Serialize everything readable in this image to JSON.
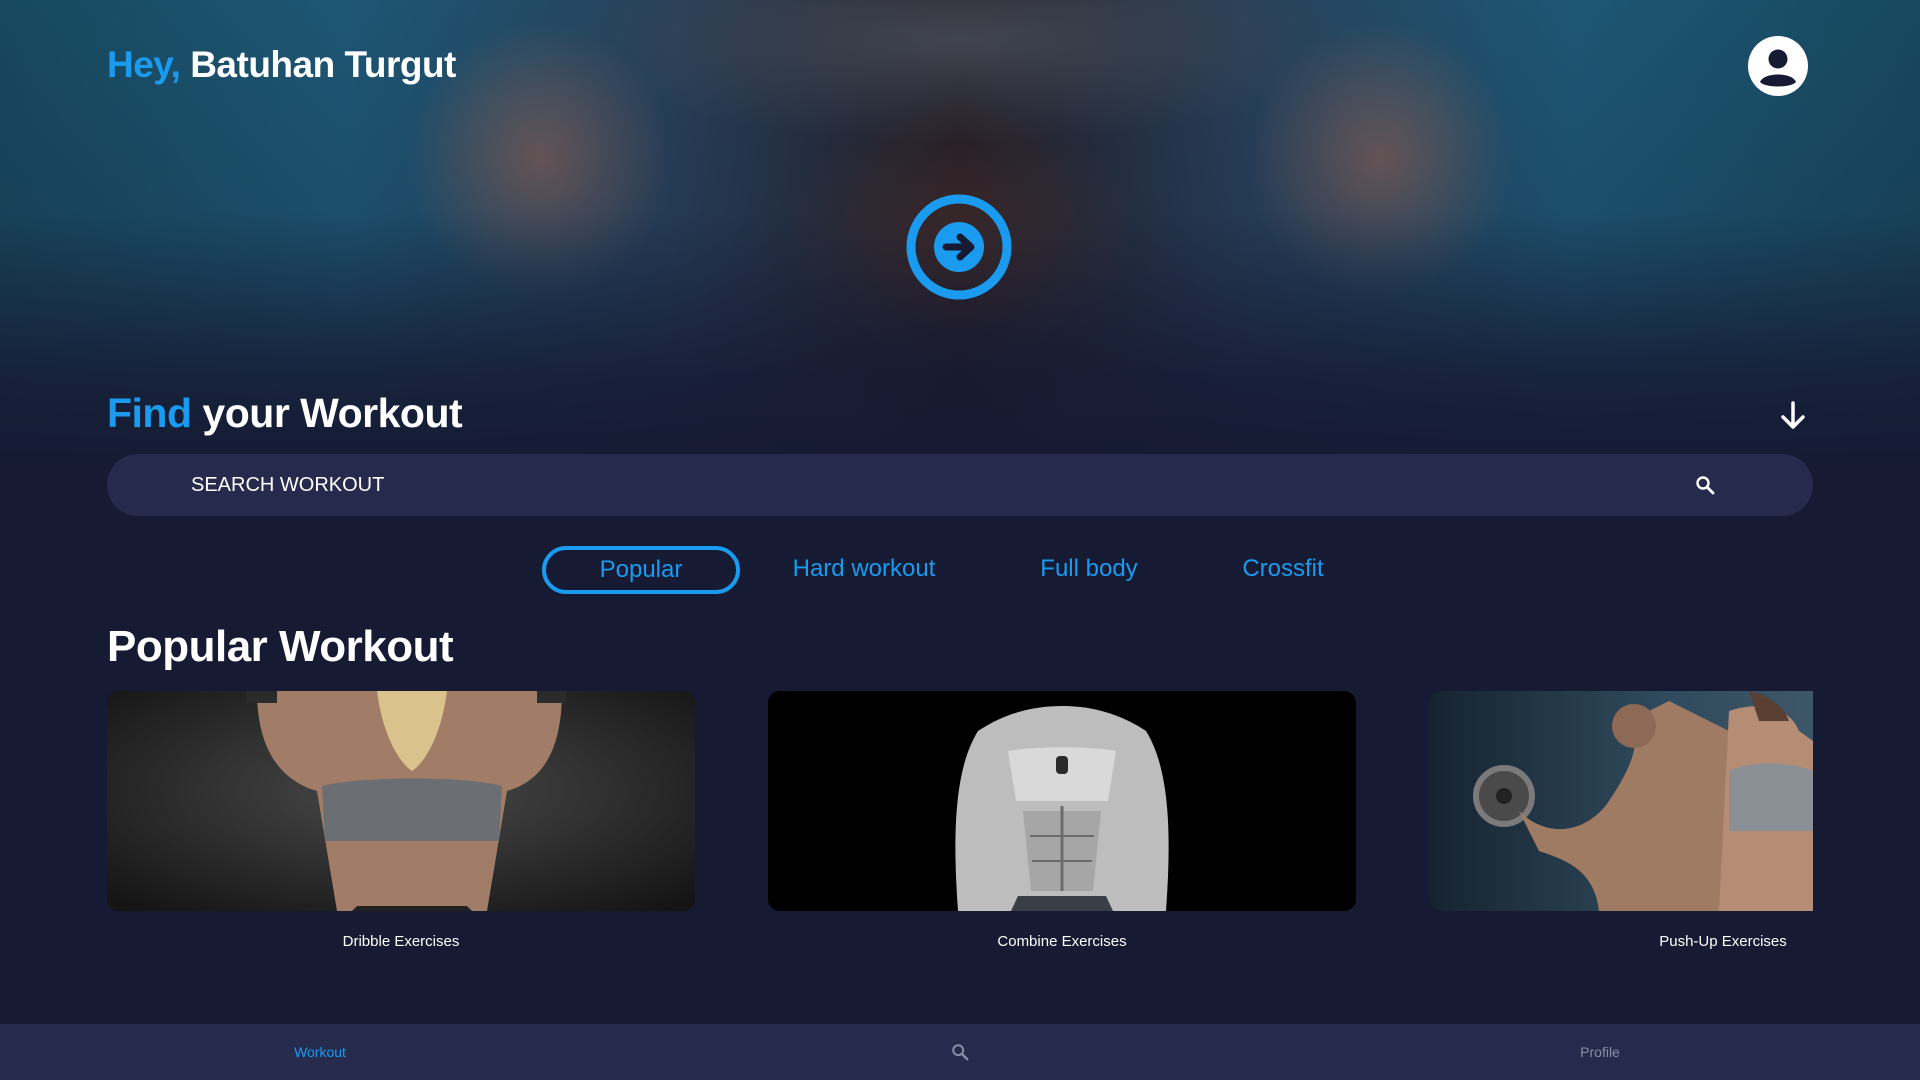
{
  "header": {
    "greeting_prefix": "Hey,",
    "user_name": "Batuhan Turgut"
  },
  "find": {
    "title_accent": "Find",
    "title_rest": " your Workout"
  },
  "search": {
    "placeholder": "SEARCH WORKOUT",
    "value": ""
  },
  "tabs": [
    {
      "label": "Popular",
      "active": true
    },
    {
      "label": "Hard workout",
      "active": false
    },
    {
      "label": "Full body",
      "active": false
    },
    {
      "label": "Crossfit",
      "active": false
    }
  ],
  "section": {
    "title": "Popular Workout"
  },
  "cards": [
    {
      "label": "Dribble Exercises"
    },
    {
      "label": "Combine Exercises"
    },
    {
      "label": "Push-Up Exercises"
    }
  ],
  "bottom_nav": {
    "workout_label": "Workout",
    "search_icon": "search-icon",
    "profile_label": "Profile"
  },
  "colors": {
    "accent": "#1a9bf0",
    "background": "#161a33",
    "surface": "#262a4d"
  }
}
